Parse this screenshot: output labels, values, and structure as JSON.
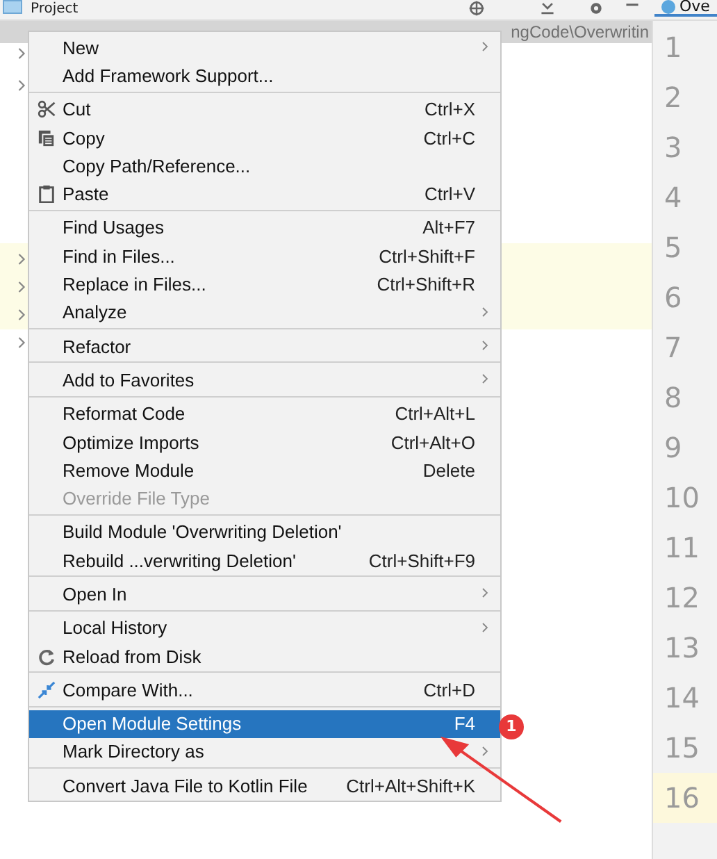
{
  "panel": {
    "title": "Project",
    "path_fragment": "ngCode\\Overwritin"
  },
  "editor": {
    "tab": "Ove",
    "line_numbers": [
      {
        "number": "1",
        "current": false
      },
      {
        "number": "2",
        "current": false
      },
      {
        "number": "3",
        "current": false
      },
      {
        "number": "4",
        "current": false
      },
      {
        "number": "5",
        "current": false
      },
      {
        "number": "6",
        "current": false
      },
      {
        "number": "7",
        "current": false
      },
      {
        "number": "8",
        "current": false
      },
      {
        "number": "9",
        "current": false
      },
      {
        "number": "10",
        "current": false
      },
      {
        "number": "11",
        "current": false
      },
      {
        "number": "12",
        "current": false
      },
      {
        "number": "13",
        "current": false
      },
      {
        "number": "14",
        "current": false
      },
      {
        "number": "15",
        "current": false
      },
      {
        "number": "16",
        "current": true
      }
    ]
  },
  "context_menu": {
    "groups": [
      [
        {
          "kind": "text",
          "label": "New",
          "submenu": true,
          "disabled": false,
          "selected": false
        },
        {
          "kind": "text",
          "label": "Add Framework Support...",
          "submenu": false,
          "disabled": false,
          "selected": false
        }
      ],
      [
        {
          "kind": "cut",
          "label": "Cut",
          "shortcut": "Ctrl+X",
          "submenu": false,
          "disabled": false,
          "selected": false
        },
        {
          "kind": "copy",
          "label": "Copy",
          "shortcut": "Ctrl+C",
          "submenu": false,
          "disabled": false,
          "selected": false
        },
        {
          "kind": "text",
          "label": "Copy Path/Reference...",
          "submenu": false,
          "disabled": false,
          "selected": false
        },
        {
          "kind": "paste",
          "label": "Paste",
          "shortcut": "Ctrl+V",
          "submenu": false,
          "disabled": false,
          "selected": false
        }
      ],
      [
        {
          "kind": "text",
          "label": "Find Usages",
          "shortcut": "Alt+F7",
          "submenu": false,
          "disabled": false,
          "selected": false
        },
        {
          "kind": "text",
          "label": "Find in Files...",
          "shortcut": "Ctrl+Shift+F",
          "submenu": false,
          "disabled": false,
          "selected": false
        },
        {
          "kind": "text",
          "label": "Replace in Files...",
          "shortcut": "Ctrl+Shift+R",
          "submenu": false,
          "disabled": false,
          "selected": false
        },
        {
          "kind": "text",
          "label": "Analyze",
          "submenu": true,
          "disabled": false,
          "selected": false
        }
      ],
      [
        {
          "kind": "text",
          "label": "Refactor",
          "submenu": true,
          "disabled": false,
          "selected": false
        }
      ],
      [
        {
          "kind": "text",
          "label": "Add to Favorites",
          "submenu": true,
          "disabled": false,
          "selected": false
        }
      ],
      [
        {
          "kind": "text",
          "label": "Reformat Code",
          "shortcut": "Ctrl+Alt+L",
          "submenu": false,
          "disabled": false,
          "selected": false
        },
        {
          "kind": "text",
          "label": "Optimize Imports",
          "shortcut": "Ctrl+Alt+O",
          "submenu": false,
          "disabled": false,
          "selected": false
        },
        {
          "kind": "text",
          "label": "Remove Module",
          "shortcut": "Delete",
          "submenu": false,
          "disabled": false,
          "selected": false
        },
        {
          "kind": "text",
          "label": "Override File Type",
          "submenu": false,
          "disabled": true,
          "selected": false
        }
      ],
      [
        {
          "kind": "text",
          "label": "Build Module 'Overwriting Deletion'",
          "submenu": false,
          "disabled": false,
          "selected": false
        },
        {
          "kind": "text",
          "label": "Rebuild ...verwriting Deletion'",
          "shortcut": "Ctrl+Shift+F9",
          "submenu": false,
          "disabled": false,
          "selected": false
        }
      ],
      [
        {
          "kind": "text",
          "label": "Open In",
          "submenu": true,
          "disabled": false,
          "selected": false
        }
      ],
      [
        {
          "kind": "text",
          "label": "Local History",
          "submenu": true,
          "disabled": false,
          "selected": false
        },
        {
          "kind": "reload",
          "label": "Reload from Disk",
          "submenu": false,
          "disabled": false,
          "selected": false
        }
      ],
      [
        {
          "kind": "compare",
          "label": "Compare With...",
          "shortcut": "Ctrl+D",
          "submenu": false,
          "disabled": false,
          "selected": false
        }
      ],
      [
        {
          "kind": "text",
          "label": "Open Module Settings",
          "shortcut": "F4",
          "submenu": false,
          "disabled": false,
          "selected": true
        },
        {
          "kind": "text",
          "label": "Mark Directory as",
          "submenu": true,
          "disabled": false,
          "selected": false
        }
      ],
      [
        {
          "kind": "text",
          "label": "Convert Java File to Kotlin File",
          "shortcut": "Ctrl+Alt+Shift+K",
          "submenu": false,
          "disabled": false,
          "selected": false
        }
      ]
    ]
  },
  "annotation": {
    "badge": "1"
  }
}
